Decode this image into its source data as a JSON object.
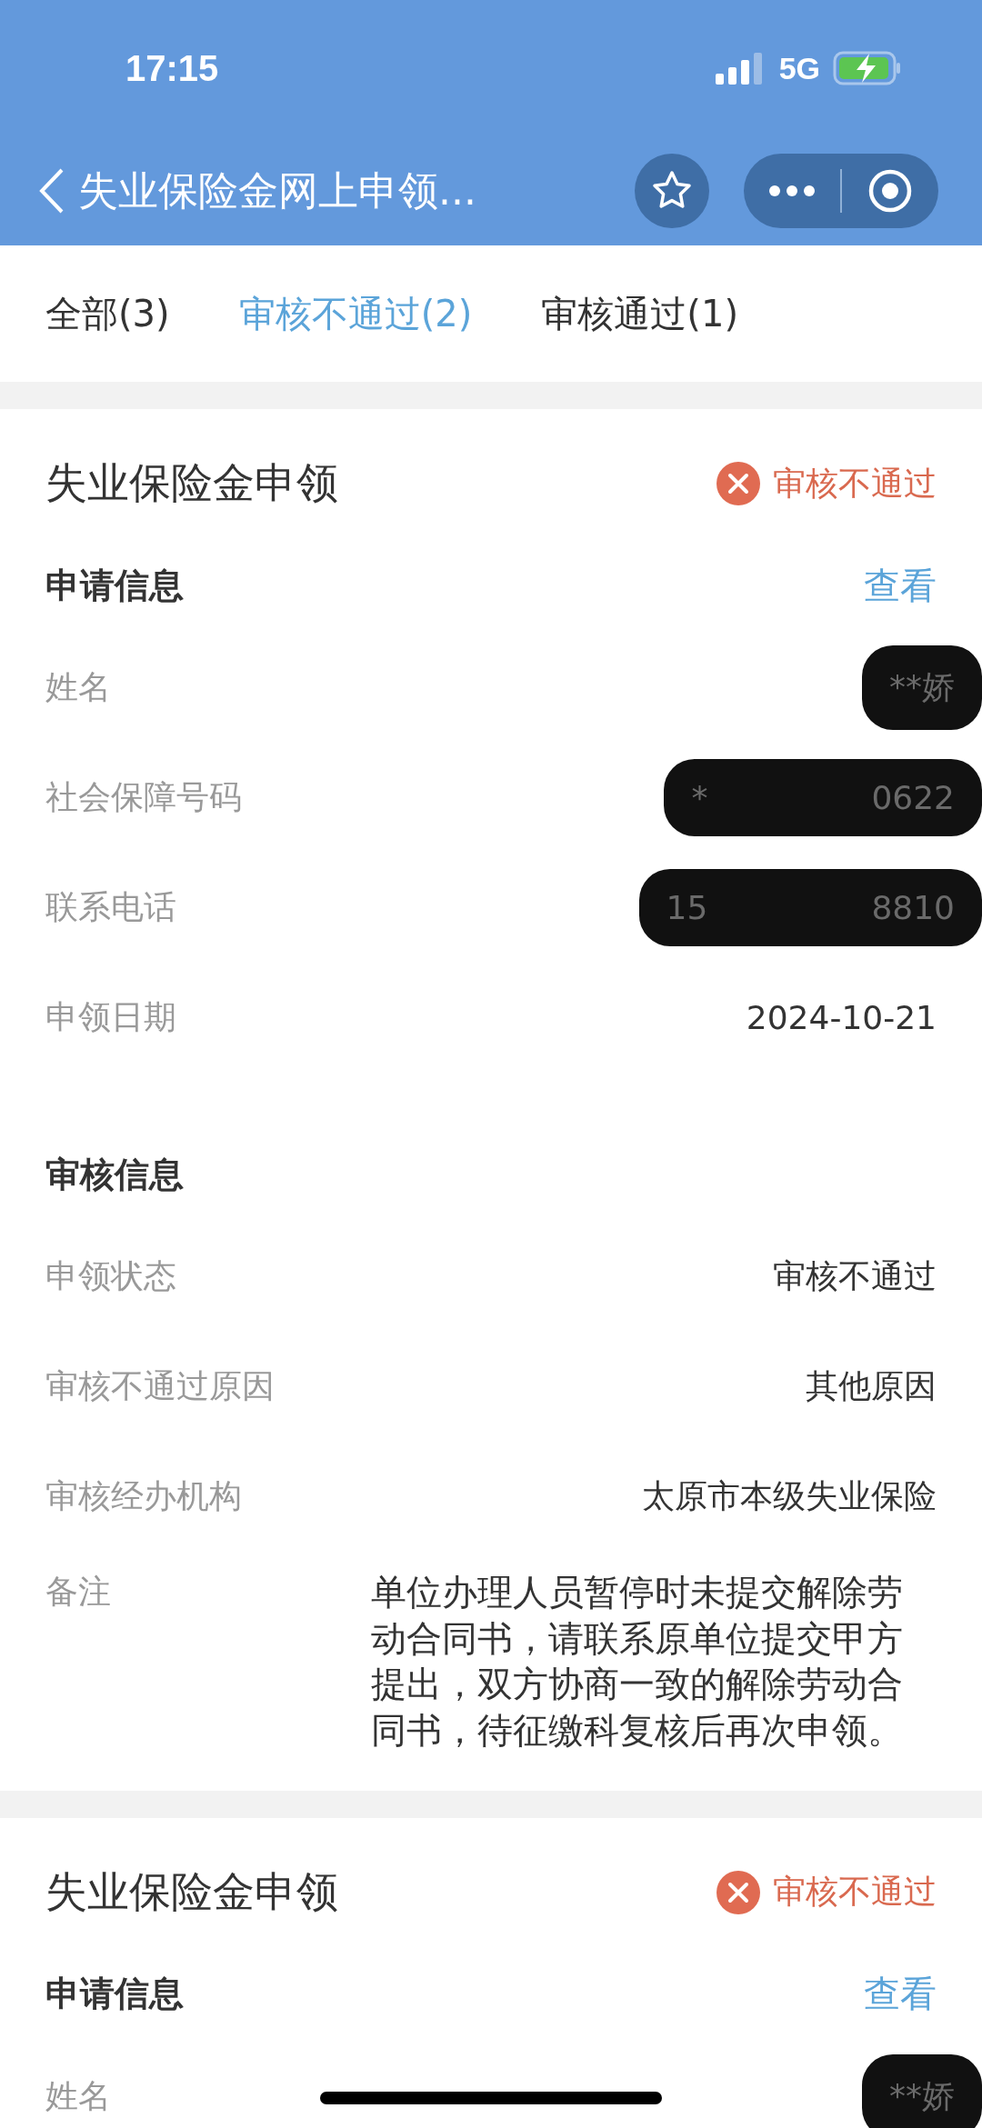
{
  "status_bar": {
    "time": "17:15",
    "network": "5G"
  },
  "nav": {
    "title": "失业保险金网上申领..."
  },
  "tabs": [
    {
      "label": "全部(3)",
      "selected": false
    },
    {
      "label": "审核不通过(2)",
      "selected": true
    },
    {
      "label": "审核通过(1)",
      "selected": false
    }
  ],
  "cards": [
    {
      "title": "失业保险金申领",
      "status": "审核不通过",
      "sections": [
        {
          "heading": "申请信息",
          "action": "查看",
          "rows": [
            {
              "label": "姓名",
              "parts": [
                "**娇"
              ],
              "kind": "redacted"
            },
            {
              "label": "社会保障号码",
              "parts": [
                "*",
                "0622"
              ],
              "kind": "redacted"
            },
            {
              "label": "联系电话",
              "parts": [
                "15",
                "8810"
              ],
              "kind": "redacted"
            },
            {
              "label": "申领日期",
              "parts": [
                "2024-10-21"
              ],
              "kind": "text"
            }
          ]
        },
        {
          "heading": "审核信息",
          "rows": [
            {
              "label": "申领状态",
              "parts": [
                "审核不通过"
              ],
              "kind": "text"
            },
            {
              "label": "审核不通过原因",
              "parts": [
                "其他原因"
              ],
              "kind": "text"
            },
            {
              "label": "审核经办机构",
              "parts": [
                "太原市本级失业保险"
              ],
              "kind": "text"
            },
            {
              "label": "备注",
              "parts": [
                "单位办理人员暂停时未提交解除劳动合同书，请联系原单位提交甲方提出，双方协商一致的解除劳动合同书，待征缴科复核后再次申领。"
              ],
              "kind": "note"
            }
          ]
        }
      ]
    },
    {
      "title": "失业保险金申领",
      "status": "审核不通过",
      "sections": [
        {
          "heading": "申请信息",
          "action": "查看",
          "rows": [
            {
              "label": "姓名",
              "parts": [
                "**娇"
              ],
              "kind": "redacted"
            }
          ]
        }
      ]
    }
  ]
}
